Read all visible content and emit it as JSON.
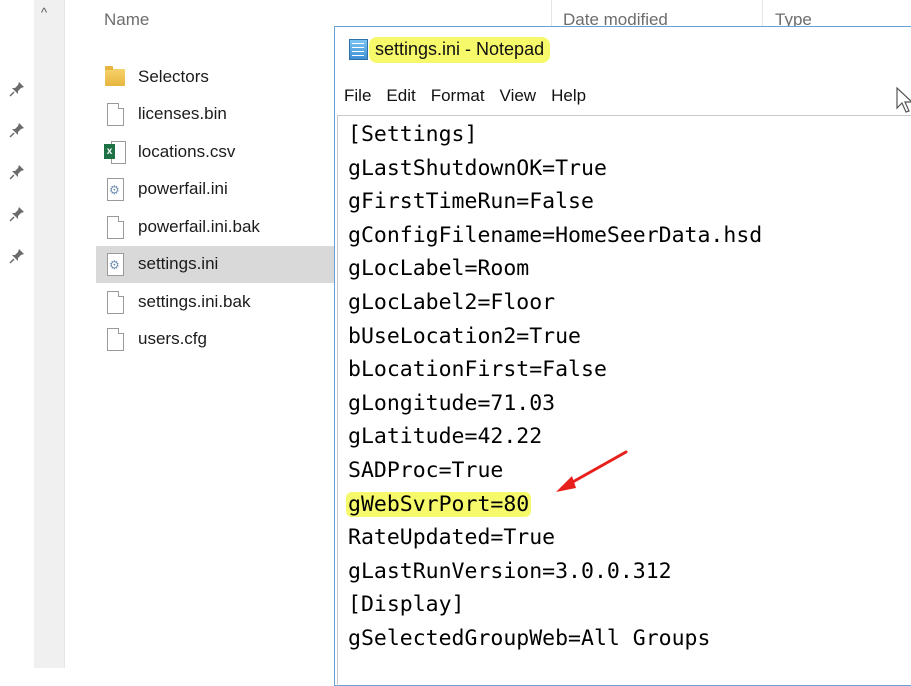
{
  "explorer": {
    "columns": {
      "name": "Name",
      "date_modified": "Date modified",
      "type": "Type"
    },
    "files": [
      {
        "name": "Selectors",
        "icon": "folder-icon",
        "selected": false
      },
      {
        "name": "licenses.bin",
        "icon": "file-icon",
        "selected": false
      },
      {
        "name": "locations.csv",
        "icon": "excel-csv-icon",
        "selected": false
      },
      {
        "name": "powerfail.ini",
        "icon": "settings-file-icon",
        "selected": false
      },
      {
        "name": "powerfail.ini.bak",
        "icon": "file-icon",
        "selected": false
      },
      {
        "name": "settings.ini",
        "icon": "settings-file-icon",
        "selected": true
      },
      {
        "name": "settings.ini.bak",
        "icon": "file-icon",
        "selected": false
      },
      {
        "name": "users.cfg",
        "icon": "file-icon",
        "selected": false
      }
    ],
    "pin_count": 5
  },
  "notepad": {
    "title": "settings.ini - Notepad",
    "menu": [
      "File",
      "Edit",
      "Format",
      "View",
      "Help"
    ],
    "lines": [
      "[Settings]",
      "gLastShutdownOK=True",
      "gFirstTimeRun=False",
      "gConfigFilename=HomeSeerData.hsd",
      "gLocLabel=Room",
      "gLocLabel2=Floor",
      "bUseLocation2=True",
      "bLocationFirst=False",
      "gLongitude=71.03",
      "gLatitude=42.22",
      "SADProc=True",
      "gWebSvrPort=80",
      "RateUpdated=True",
      "gLastRunVersion=3.0.0.312",
      "[Display]",
      "gSelectedGroupWeb=All Groups"
    ],
    "highlighted_line_index": 11
  },
  "colors": {
    "highlight": "#f6f96a",
    "arrow": "#e8201c",
    "selected_row": "#d9d9d9"
  }
}
